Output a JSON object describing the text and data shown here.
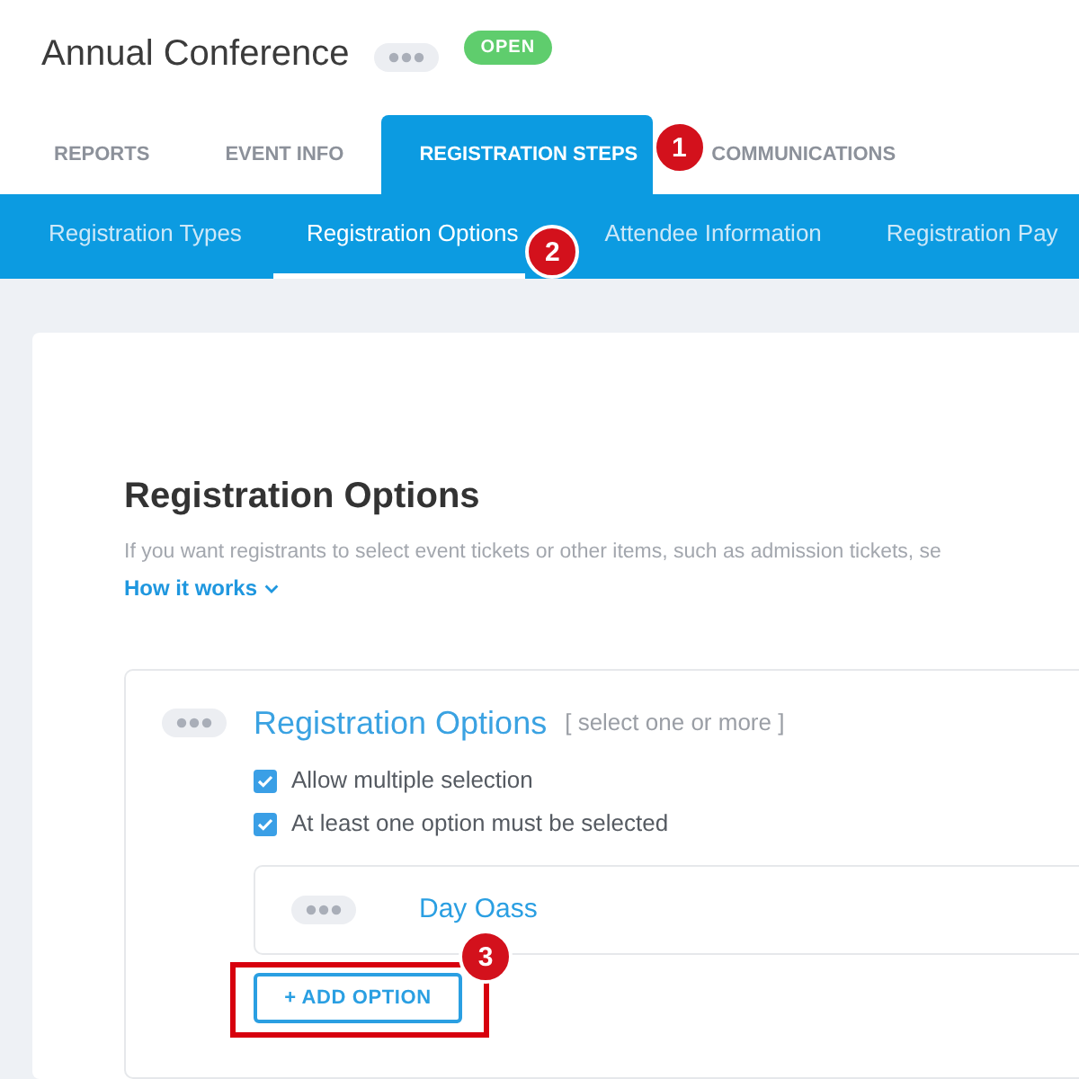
{
  "event": {
    "title": "Annual Conference",
    "status": "OPEN"
  },
  "tabs": [
    {
      "label": "REPORTS",
      "selected": false
    },
    {
      "label": "EVENT INFO",
      "selected": false
    },
    {
      "label": "REGISTRATION STEPS",
      "selected": true,
      "callout": "1"
    },
    {
      "label": "COMMUNICATIONS",
      "selected": false
    }
  ],
  "subtabs": [
    {
      "label": "Registration Types",
      "selected": false
    },
    {
      "label": "Registration Options",
      "selected": true,
      "callout": "2"
    },
    {
      "label": "Attendee Information",
      "selected": false
    },
    {
      "label": "Registration Pay",
      "selected": false
    }
  ],
  "section": {
    "heading": "Registration Options",
    "description": "If you want registrants to select event tickets or other items, such as admission tickets, se",
    "link": "How it works"
  },
  "option_group": {
    "title": "Registration Options",
    "hint": "[ select one or more ]",
    "settings": [
      {
        "label": "Allow multiple selection",
        "checked": true
      },
      {
        "label": "At least one option must be selected",
        "checked": true
      }
    ],
    "options": [
      {
        "name": "Day Oass"
      }
    ],
    "add_button": {
      "label": "+ ADD OPTION",
      "highlighted": true,
      "callout": "3"
    }
  }
}
